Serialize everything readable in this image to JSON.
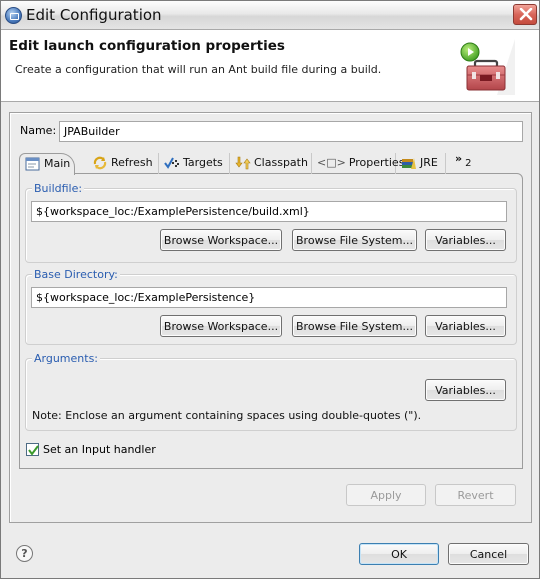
{
  "window": {
    "title": "Edit Configuration",
    "close_icon": "close-icon",
    "app_icon": "eclipse-app-icon"
  },
  "header": {
    "title": "Edit launch configuration properties",
    "subtitle": "Create a configuration that will run an Ant build file during a build.",
    "banner_icon": "ant-toolbox-run-icon"
  },
  "name_field": {
    "label": "Name:",
    "value": "JPABuilder"
  },
  "tabs": [
    {
      "label": "Main",
      "icon": "main-tab-icon",
      "selected": true
    },
    {
      "label": "Refresh",
      "icon": "refresh-icon",
      "selected": false
    },
    {
      "label": "Targets",
      "icon": "targets-icon",
      "selected": false
    },
    {
      "label": "Classpath",
      "icon": "classpath-icon",
      "selected": false
    },
    {
      "label": "Properties",
      "icon": "properties-icon",
      "selected": false
    },
    {
      "label": "JRE",
      "icon": "jre-icon",
      "selected": false
    },
    {
      "label": "2",
      "icon": "overflow-chevron-icon",
      "selected": false
    }
  ],
  "tabs_overflow_glyph": "»",
  "properties_glyph": "<□>",
  "buildfile": {
    "label": "Buildfile:",
    "value": "${workspace_loc:/ExamplePersistence/build.xml}",
    "buttons": [
      "Browse Workspace...",
      "Browse File System...",
      "Variables..."
    ]
  },
  "base_directory": {
    "label": "Base Directory:",
    "value": "${workspace_loc:/ExamplePersistence}",
    "buttons": [
      "Browse Workspace...",
      "Browse File System...",
      "Variables..."
    ]
  },
  "arguments": {
    "label": "Arguments:",
    "value": "",
    "variables_button": "Variables...",
    "note": "Note: Enclose an argument containing spaces using double-quotes (\")."
  },
  "input_handler": {
    "label": "Set an Input handler",
    "checked": true
  },
  "apply_button": {
    "label": "Apply",
    "enabled": false
  },
  "revert_button": {
    "label": "Revert",
    "enabled": false
  },
  "ok_button": {
    "label": "OK"
  },
  "cancel_button": {
    "label": "Cancel"
  },
  "help_icon": "?",
  "colors": {
    "group_label": "#2a5db0",
    "close_button": "#d8665a",
    "check_mark": "#3a9a2a"
  }
}
